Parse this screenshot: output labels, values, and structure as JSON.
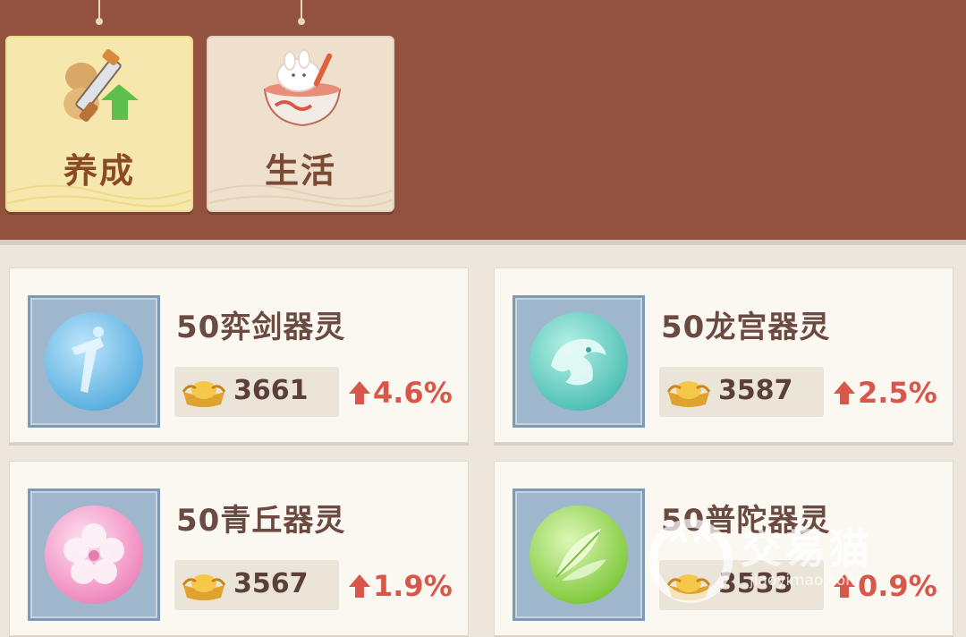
{
  "tabs": [
    {
      "label": "养成",
      "icon": "sword-upgrade-icon",
      "active": true
    },
    {
      "label": "生活",
      "icon": "rice-bowl-icon",
      "active": false
    }
  ],
  "items": [
    {
      "name": "50弈剑器灵",
      "price": "3661",
      "change": "4.6%",
      "icon": "sword-spirit-orb-icon",
      "orb_color": "#7cc3ea"
    },
    {
      "name": "50龙宫器灵",
      "price": "3587",
      "change": "2.5%",
      "icon": "dragon-spirit-orb-icon",
      "orb_color": "#5fc9c0"
    },
    {
      "name": "50青丘器灵",
      "price": "3567",
      "change": "1.9%",
      "icon": "fox-flower-orb-icon",
      "orb_color": "#f3a7cf"
    },
    {
      "name": "50普陀器灵",
      "price": "3533",
      "change": "0.9%",
      "icon": "leaf-spirit-orb-icon",
      "orb_color": "#8fd14e"
    }
  ],
  "watermark": {
    "text": "交易猫",
    "url": "jiaoyimao.com"
  },
  "colors": {
    "header_bg": "#93523f",
    "active_tab": "#f6e8ac",
    "up": "#d9574a"
  }
}
